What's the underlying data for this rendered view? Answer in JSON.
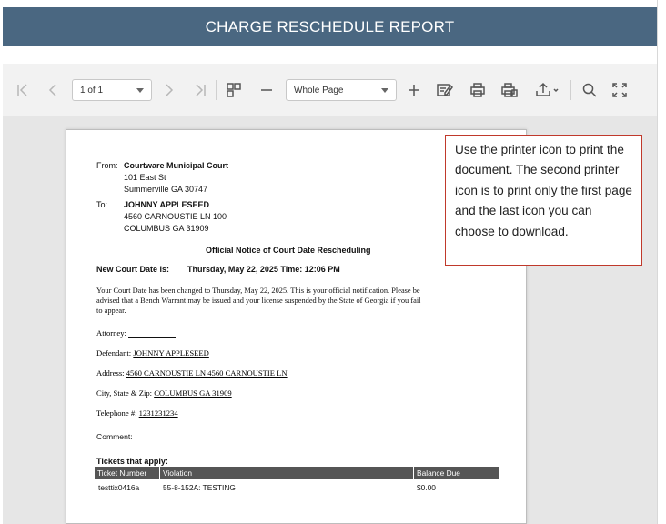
{
  "header": {
    "partial_text_before": "...",
    "partial_link": "",
    "title": "CHARGE RESCHEDULE REPORT"
  },
  "toolbar": {
    "page_indicator": "1 of 1",
    "zoom_mode": "Whole Page",
    "icons": [
      "first-page",
      "previous-page",
      "next-page",
      "last-page",
      "toggle-sidebar",
      "zoom-out",
      "zoom-in",
      "edit",
      "print",
      "print-page",
      "export",
      "search",
      "full-screen"
    ]
  },
  "report": {
    "from_label": "From:",
    "from_name": "Courtware Municipal Court",
    "from_street": "101 East St",
    "from_city": "Summerville GA 30747",
    "to_label": "To:",
    "to_name": "JOHNNY APPLESEED",
    "to_street": "4560 CARNOUSTIE LN 100",
    "to_city": "COLUMBUS GA 31909",
    "notice_title": "Official Notice of Court Date Rescheduling",
    "new_date_label": "New Court Date is:",
    "new_date_value": "Thursday, May 22, 2025 Time: 12:06 PM",
    "para_line1": "Your Court Date has been changed to Thursday, May 22, 2025. This is your official notification. Please be",
    "para_line2": "advised that a Bench Warrant may be issued and your license suspended by the State of Georgia if you fail",
    "para_line3": "to appear.",
    "attorney_label": "Attorney:",
    "defendant_label": "Defendant:",
    "defendant_value": "JOHNNY APPLESEED",
    "address_label": "Address:",
    "address_value": "4560 CARNOUSTIE LN 4560 CARNOUSTIE LN",
    "city_label": "City, State & Zip:",
    "city_value": "COLUMBUS GA 31909",
    "telephone_label": "Telephone #:",
    "telephone_value": "1231231234",
    "comment_label": "Comment:",
    "tickets_title": "Tickets that apply:",
    "table_headers": [
      "Ticket Number",
      "Violation",
      "Balance Due"
    ],
    "table_rows": [
      [
        "testtix0416a",
        "55-8-152A: TESTING",
        "$0.00"
      ]
    ]
  },
  "callout": {
    "text": "Use the printer icon to print the document.  The second printer icon is to print only the first page and the last icon you can choose to download."
  },
  "colors": {
    "title_bar": "#4a6781",
    "toolbar_bg": "#f2f2f2",
    "viewer_bg": "#e6e6e6",
    "table_header": "#555555",
    "callout_border": "#c0392b"
  }
}
